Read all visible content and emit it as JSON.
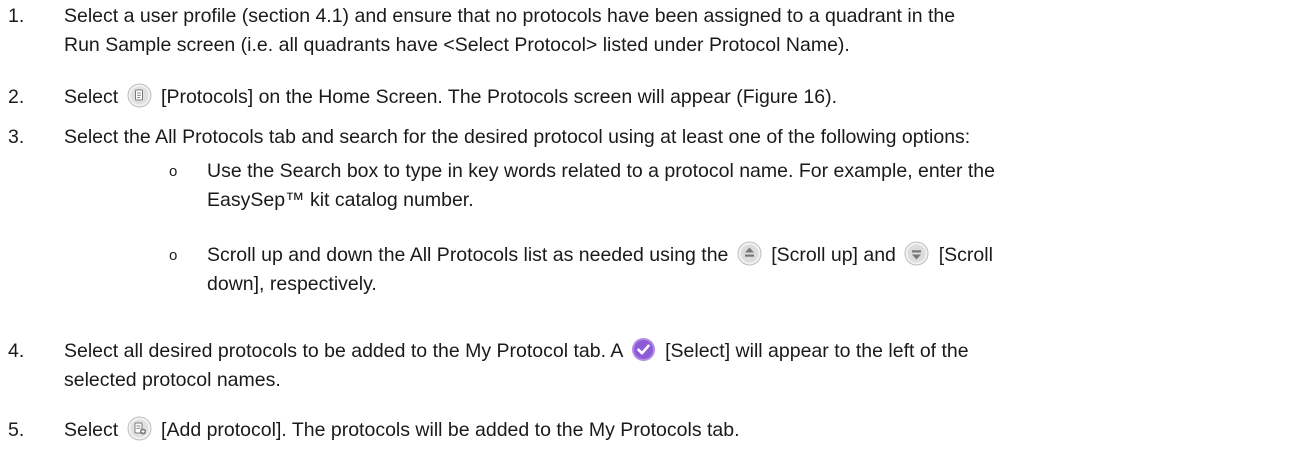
{
  "steps": [
    {
      "number": "1.",
      "line1": "Select a user profile (section 4.1) and ensure that no protocols have been assigned to a quadrant in the",
      "line2": "Run Sample screen (i.e. all quadrants have <Select Protocol> listed under Protocol Name)."
    },
    {
      "number": "2.",
      "before": "Select",
      "icon": "protocols-icon",
      "after": "[Protocols] on the Home Screen. The Protocols screen will appear (Figure 16)."
    },
    {
      "number": "3.",
      "text": "Select the All Protocols tab and search for the desired protocol using at least one of the following options:",
      "bullets": [
        {
          "marker": "o",
          "line1": "Use the Search box to type in key words related to a protocol name. For example, enter the",
          "line2": "EasySep™ kit catalog number."
        },
        {
          "marker": "o",
          "before": "Scroll up and down the All Protocols list as needed using the",
          "icon1": "scroll-up-icon",
          "middle": "[Scroll up] and",
          "icon2": "scroll-down-icon",
          "after": "[Scroll",
          "line2": "down], respectively."
        }
      ]
    },
    {
      "number": "4.",
      "before": "Select all desired protocols to be added to the My Protocol tab. A",
      "icon": "select-checkmark-icon",
      "after": "[Select] will appear to the left of the",
      "line2": "selected protocol names."
    },
    {
      "number": "5.",
      "before": "Select",
      "icon": "add-protocol-icon",
      "after": "[Add protocol]. The protocols will be added to the My Protocols tab."
    }
  ],
  "colors": {
    "text": "#1a1a1a",
    "icon_grey": "#d9d9d9",
    "select_purple": "#8e5bd6"
  }
}
